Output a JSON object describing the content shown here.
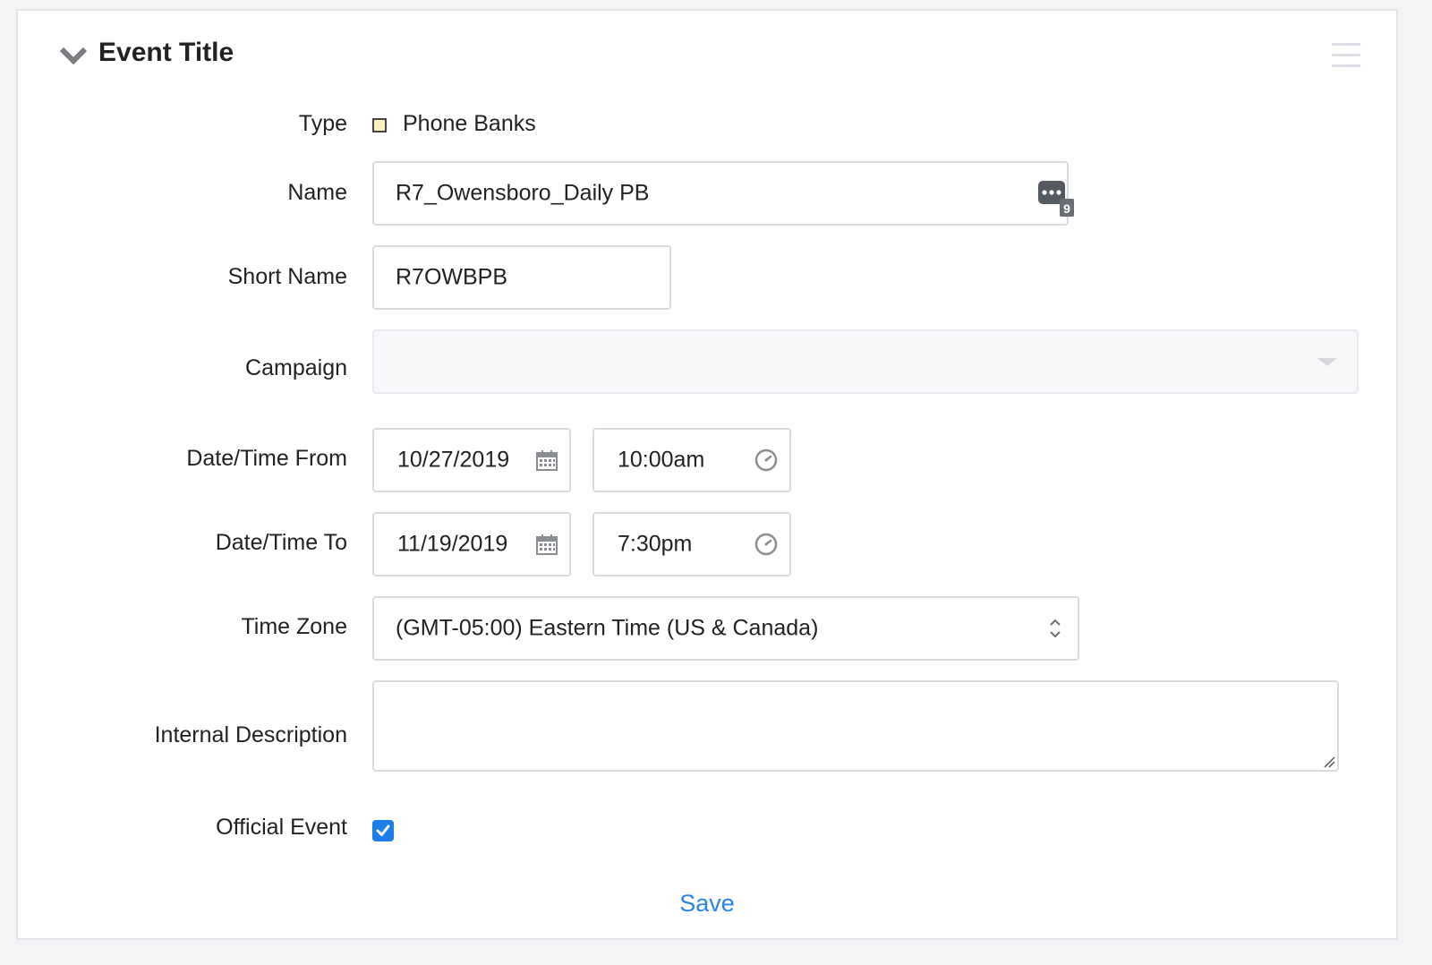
{
  "header": {
    "title": "Event Title"
  },
  "form": {
    "type": {
      "label": "Type",
      "value": "Phone Banks",
      "swatch_color": "#fbf3bf"
    },
    "name": {
      "label": "Name",
      "value": "R7_Owensboro_Daily PB",
      "badge_count": "9"
    },
    "short_name": {
      "label": "Short Name",
      "value": "R7OWBPB"
    },
    "campaign": {
      "label": "Campaign",
      "value": ""
    },
    "from": {
      "label": "Date/Time From",
      "date": "10/27/2019",
      "time": "10:00am"
    },
    "to": {
      "label": "Date/Time To",
      "date": "11/19/2019",
      "time": "7:30pm"
    },
    "timezone": {
      "label": "Time Zone",
      "value": "(GMT-05:00) Eastern Time (US & Canada)"
    },
    "description": {
      "label": "Internal Description",
      "value": ""
    },
    "official": {
      "label": "Official Event",
      "checked": true
    }
  },
  "actions": {
    "save_label": "Save"
  },
  "colors": {
    "accent": "#1c7ee8",
    "link": "#2a86e0",
    "border": "#d8dade"
  },
  "icons": [
    "chevron-down-icon",
    "hamburger-menu-icon",
    "chat-bubble-icon",
    "calendar-icon",
    "clock-icon",
    "updown-arrows-icon",
    "resize-grip-icon",
    "checkmark-icon"
  ]
}
